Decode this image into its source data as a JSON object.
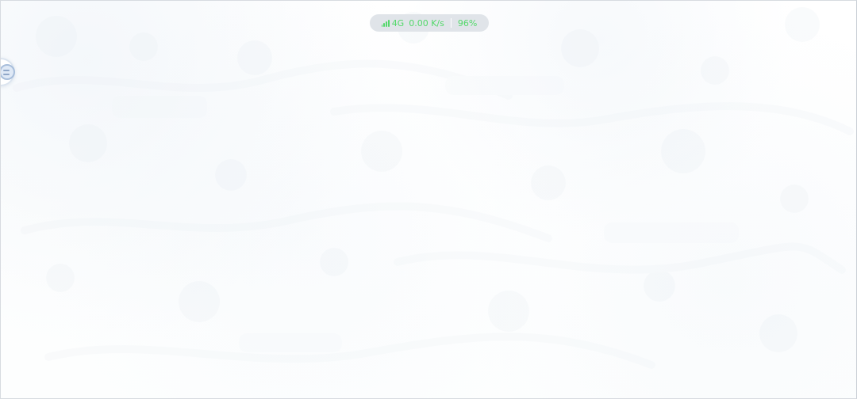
{
  "status": {
    "network": "4G",
    "speed": "0.00 K/s",
    "battery": "96%",
    "signal_icon": "signal-icon",
    "text_color": "#53D86A",
    "pill_color": "#DDE2E7"
  },
  "edge_control": {
    "icon": "side-handle-icon",
    "ring_color": "#DBE4EF",
    "icon_color": "#8FA7C8"
  }
}
